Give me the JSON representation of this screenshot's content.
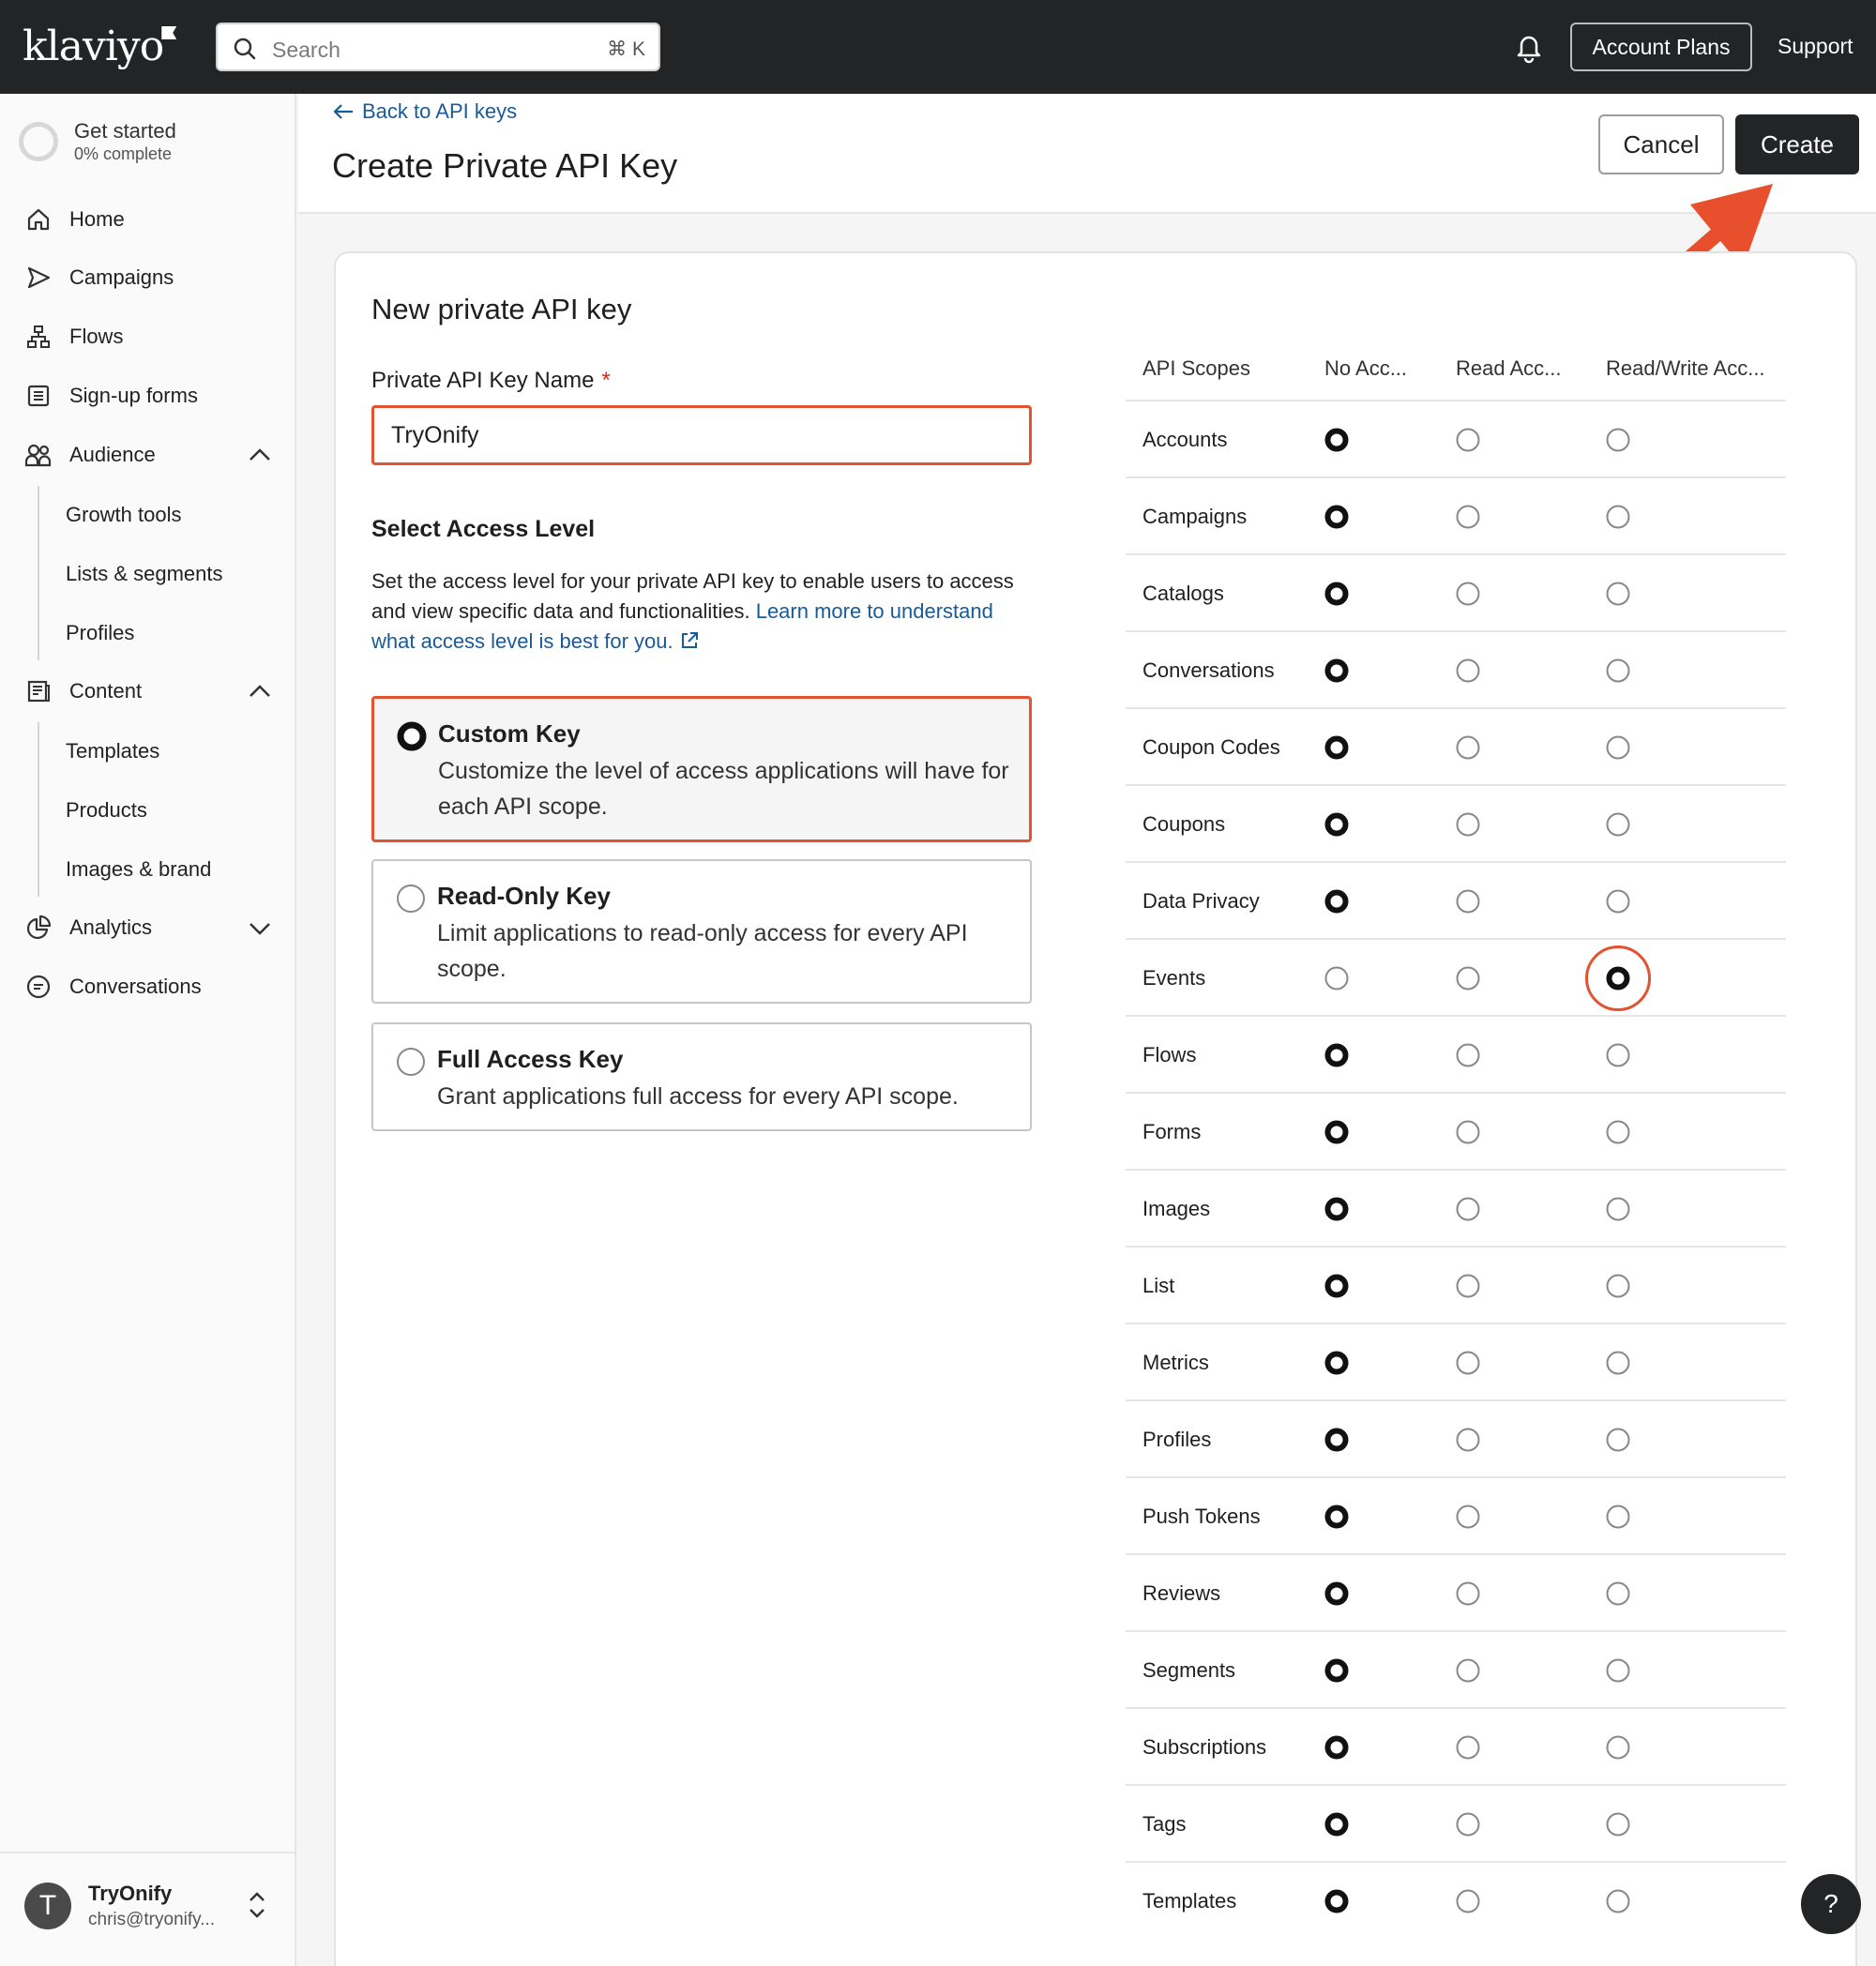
{
  "topbar": {
    "logo": "klaviyo",
    "search_placeholder": "Search",
    "search_shortcut": "⌘ K",
    "account_plans": "Account Plans",
    "support": "Support"
  },
  "sidebar": {
    "get_started": {
      "title": "Get started",
      "progress": "0% complete"
    },
    "items": [
      {
        "label": "Home",
        "icon": "home-icon"
      },
      {
        "label": "Campaigns",
        "icon": "send-icon"
      },
      {
        "label": "Flows",
        "icon": "flows-icon"
      },
      {
        "label": "Sign-up forms",
        "icon": "form-icon"
      },
      {
        "label": "Audience",
        "icon": "audience-icon"
      },
      {
        "label": "Content",
        "icon": "content-icon"
      },
      {
        "label": "Analytics",
        "icon": "analytics-icon"
      },
      {
        "label": "Conversations",
        "icon": "chat-icon"
      }
    ],
    "audience_sub": [
      "Growth tools",
      "Lists & segments",
      "Profiles"
    ],
    "content_sub": [
      "Templates",
      "Products",
      "Images & brand"
    ],
    "account": {
      "initial": "T",
      "name": "TryOnify",
      "email": "chris@tryonify..."
    }
  },
  "header": {
    "back_link": "Back to API keys",
    "title": "Create Private API Key",
    "cancel": "Cancel",
    "create": "Create"
  },
  "form": {
    "card_title": "New private API key",
    "name_label": "Private API Key Name",
    "required_mark": "*",
    "name_value": "TryOnify",
    "access_title": "Select Access Level",
    "access_desc": "Set the access level for your private API key to enable users to access and view specific data and functionalities.",
    "access_link": "Learn more to understand what access level is best for you.",
    "options": [
      {
        "title": "Custom Key",
        "desc": "Customize the level of access applications will have for each API scope.",
        "selected": true
      },
      {
        "title": "Read-Only Key",
        "desc": "Limit applications to read-only access for every API scope.",
        "selected": false
      },
      {
        "title": "Full Access Key",
        "desc": "Grant applications full access for every API scope.",
        "selected": false
      }
    ]
  },
  "scopes": {
    "headers": [
      "API Scopes",
      "No Acc...",
      "Read Acc...",
      "Read/Write Acc..."
    ],
    "rows": [
      {
        "name": "Accounts",
        "level": "none"
      },
      {
        "name": "Campaigns",
        "level": "none"
      },
      {
        "name": "Catalogs",
        "level": "none"
      },
      {
        "name": "Conversations",
        "level": "none"
      },
      {
        "name": "Coupon Codes",
        "level": "none"
      },
      {
        "name": "Coupons",
        "level": "none"
      },
      {
        "name": "Data Privacy",
        "level": "none"
      },
      {
        "name": "Events",
        "level": "readwrite"
      },
      {
        "name": "Flows",
        "level": "none"
      },
      {
        "name": "Forms",
        "level": "none"
      },
      {
        "name": "Images",
        "level": "none"
      },
      {
        "name": "List",
        "level": "none"
      },
      {
        "name": "Metrics",
        "level": "none"
      },
      {
        "name": "Profiles",
        "level": "none"
      },
      {
        "name": "Push Tokens",
        "level": "none"
      },
      {
        "name": "Reviews",
        "level": "none"
      },
      {
        "name": "Segments",
        "level": "none"
      },
      {
        "name": "Subscriptions",
        "level": "none"
      },
      {
        "name": "Tags",
        "level": "none"
      },
      {
        "name": "Templates",
        "level": "none"
      }
    ]
  },
  "help_button": "?",
  "colors": {
    "accent": "#e2532f",
    "dark": "#232426",
    "link": "#1a5a96"
  }
}
